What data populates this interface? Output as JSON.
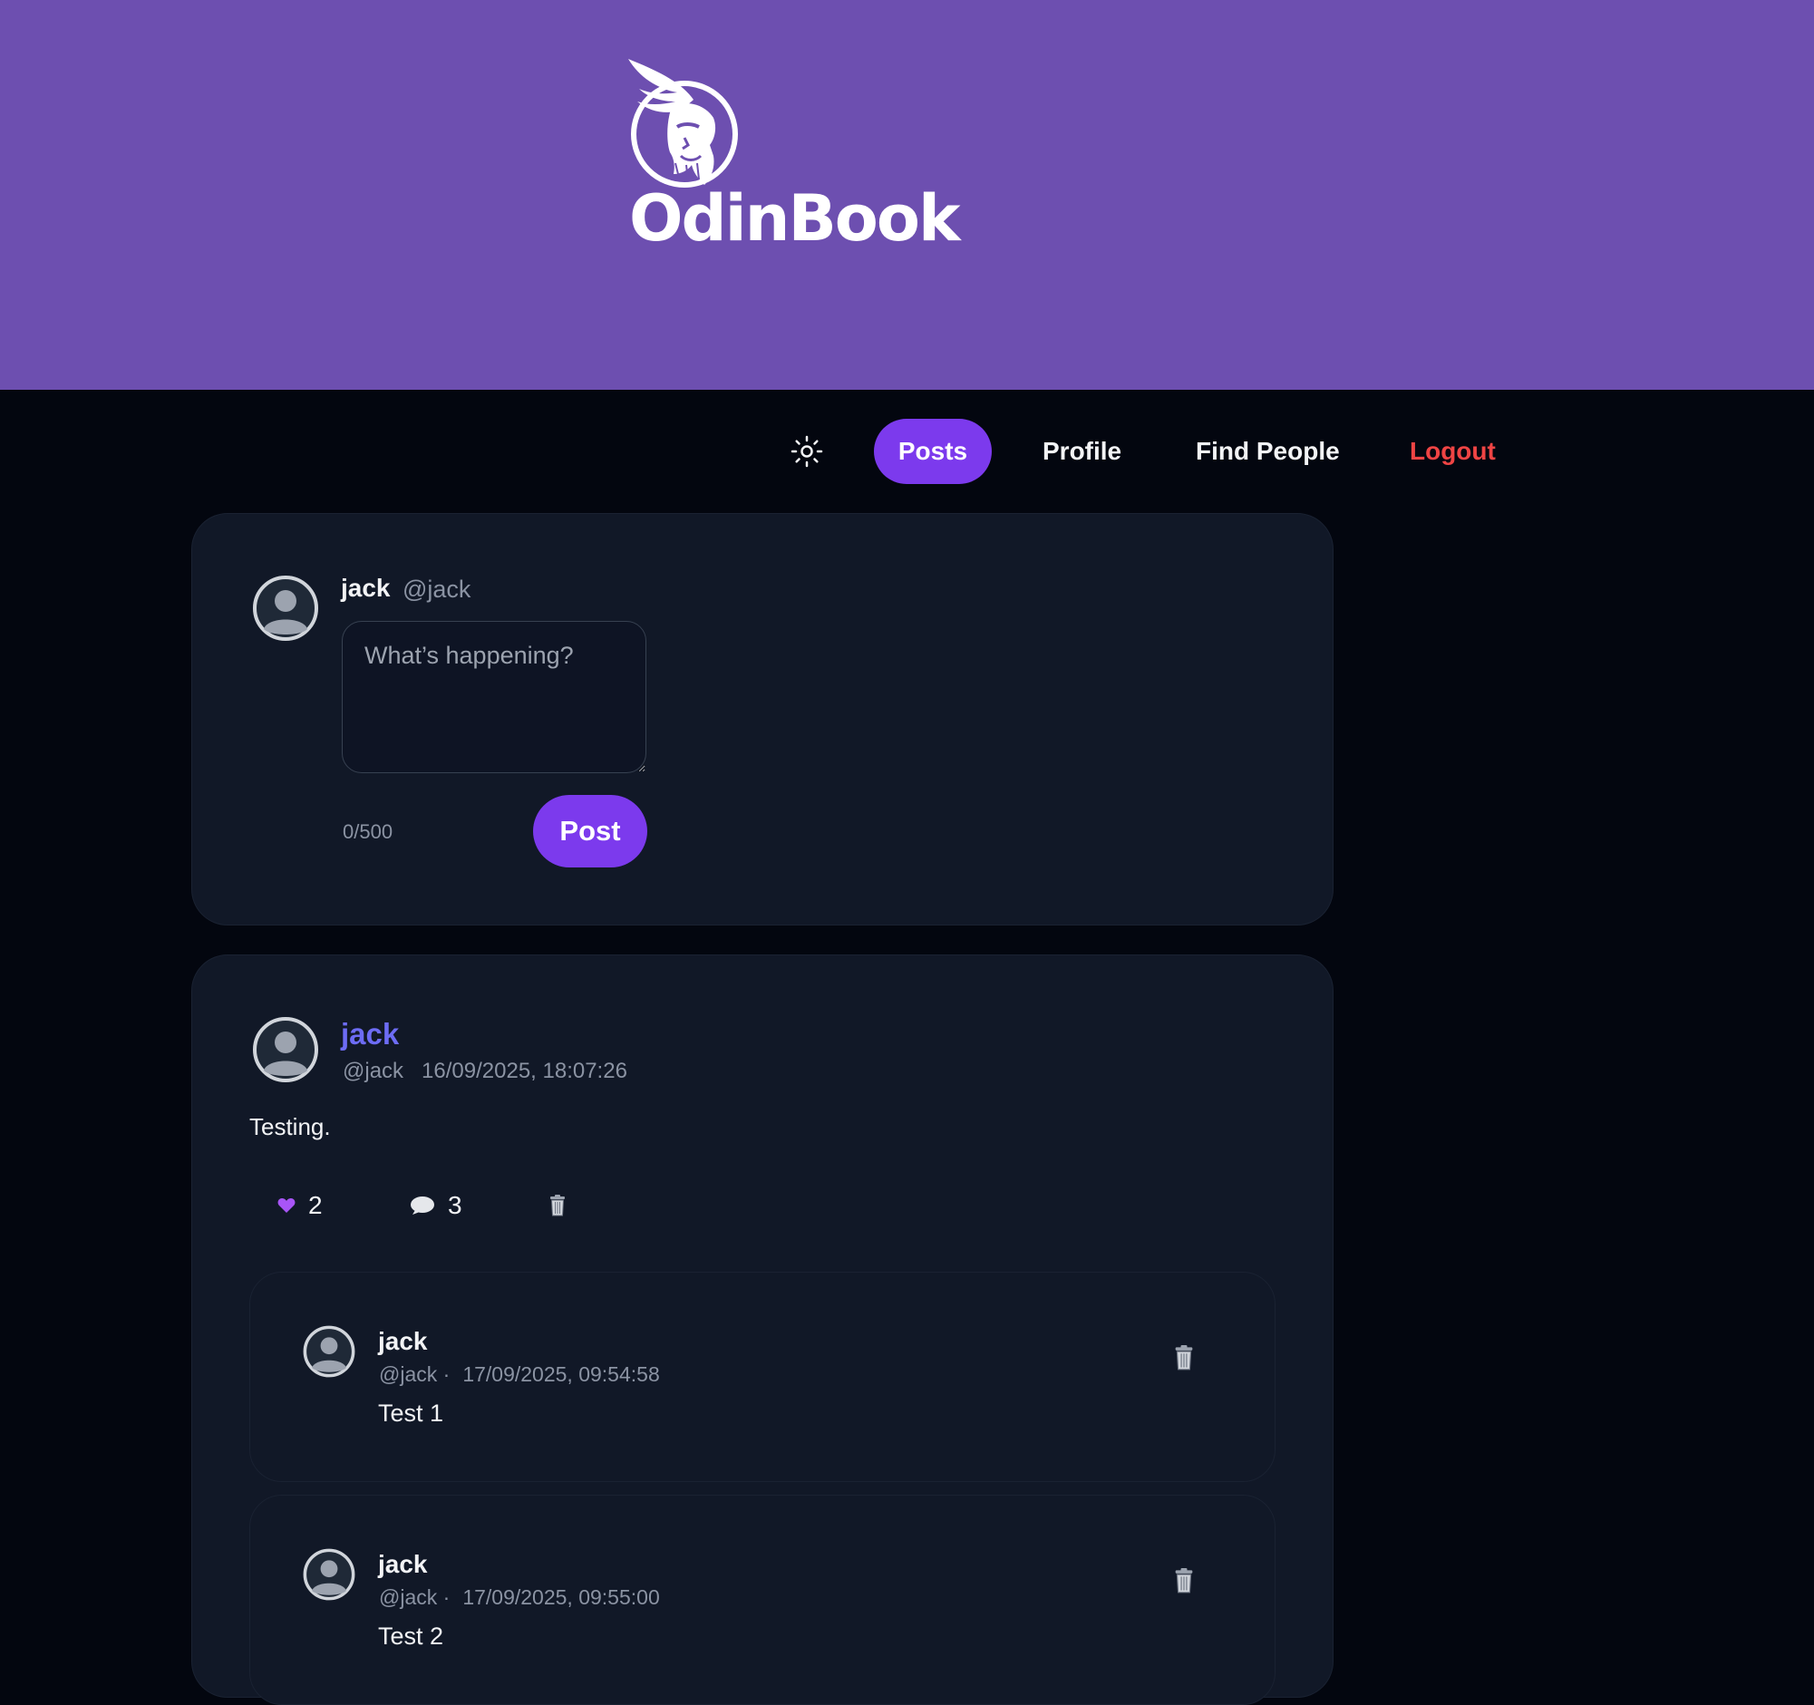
{
  "brand": {
    "name": "OdinBook",
    "banner_color": "#6d4fb0",
    "accent": "#7c3aed",
    "danger": "#ef4444",
    "link": "#6d6cf5"
  },
  "nav": {
    "theme_icon": "sun-icon",
    "items": [
      {
        "label": "Posts",
        "active": true
      },
      {
        "label": "Profile",
        "active": false
      },
      {
        "label": "Find People",
        "active": false
      },
      {
        "label": "Logout",
        "active": false
      }
    ]
  },
  "composer": {
    "name": "jack",
    "handle": "@jack",
    "placeholder": "What’s happening?",
    "value": "",
    "counter": "0/500",
    "button": "Post"
  },
  "post": {
    "author": "jack",
    "handle": "@jack",
    "timestamp": "16/09/2025, 18:07:26",
    "body": "Testing.",
    "likes": "2",
    "comments": "3",
    "comment_list": [
      {
        "author": "jack",
        "handle": "@jack ·",
        "timestamp": "17/09/2025, 09:54:58",
        "body": "Test 1"
      },
      {
        "author": "jack",
        "handle": "@jack ·",
        "timestamp": "17/09/2025, 09:55:00",
        "body": "Test 2"
      }
    ]
  }
}
